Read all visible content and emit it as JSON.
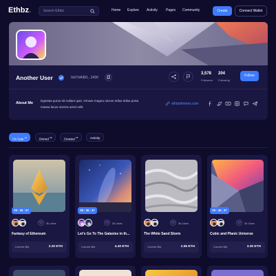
{
  "header": {
    "logo": "Ethbz",
    "logo_dot": ".",
    "search_placeholder": "Search Ethbz",
    "nav": [
      "Home",
      "Explore",
      "Activity",
      "Pages",
      "Community"
    ],
    "create_label": "Create",
    "wallet_label": "Connect Wallet"
  },
  "profile": {
    "username": "Another User",
    "wallet": "0x07d4381...2430",
    "followers_count": "3,578",
    "followers_label": "Followers",
    "following_count": "204",
    "following_label": "Following",
    "follow_label": "Follow",
    "about_title": "About Me",
    "about_text": "Egestas purus sit nullam quis. Ornare magna rutrum tellus tellus porta massa lacus viverra amet velit.",
    "website": "ethbzthemes.com"
  },
  "tabs": [
    {
      "label": "On Sale",
      "count": "24",
      "active": true
    },
    {
      "label": "Owned",
      "count": "18",
      "active": false
    },
    {
      "label": "Created",
      "count": "78",
      "active": false
    },
    {
      "label": "Activity",
      "count": "",
      "active": false
    }
  ],
  "nfts": [
    {
      "title": "Fantasy of Ethereum",
      "timer": "09 : 45 : 37",
      "likes": "3k Likes",
      "bid_label": "Current Bid",
      "bid": "2.20 ETH"
    },
    {
      "title": "Let's Go To The Galaxies in th...",
      "timer": "09 : 45 : 37",
      "likes": "3k Likes",
      "bid_label": "Current Bid",
      "bid": "4.40 ETH"
    },
    {
      "title": "The White Sand Storm",
      "timer": "",
      "likes": "3k Likes",
      "bid_label": "Current Bid",
      "bid": "2.55 ETH"
    },
    {
      "title": "Cubic and Planic Universe",
      "timer": "09 : 45 : 37",
      "likes": "3k Likes",
      "bid_label": "Current Bid",
      "bid": "3.30 ETH"
    }
  ],
  "colors": {
    "accent": "#3e7bff",
    "background": "#0e0b2b",
    "card": "#1a1742"
  }
}
